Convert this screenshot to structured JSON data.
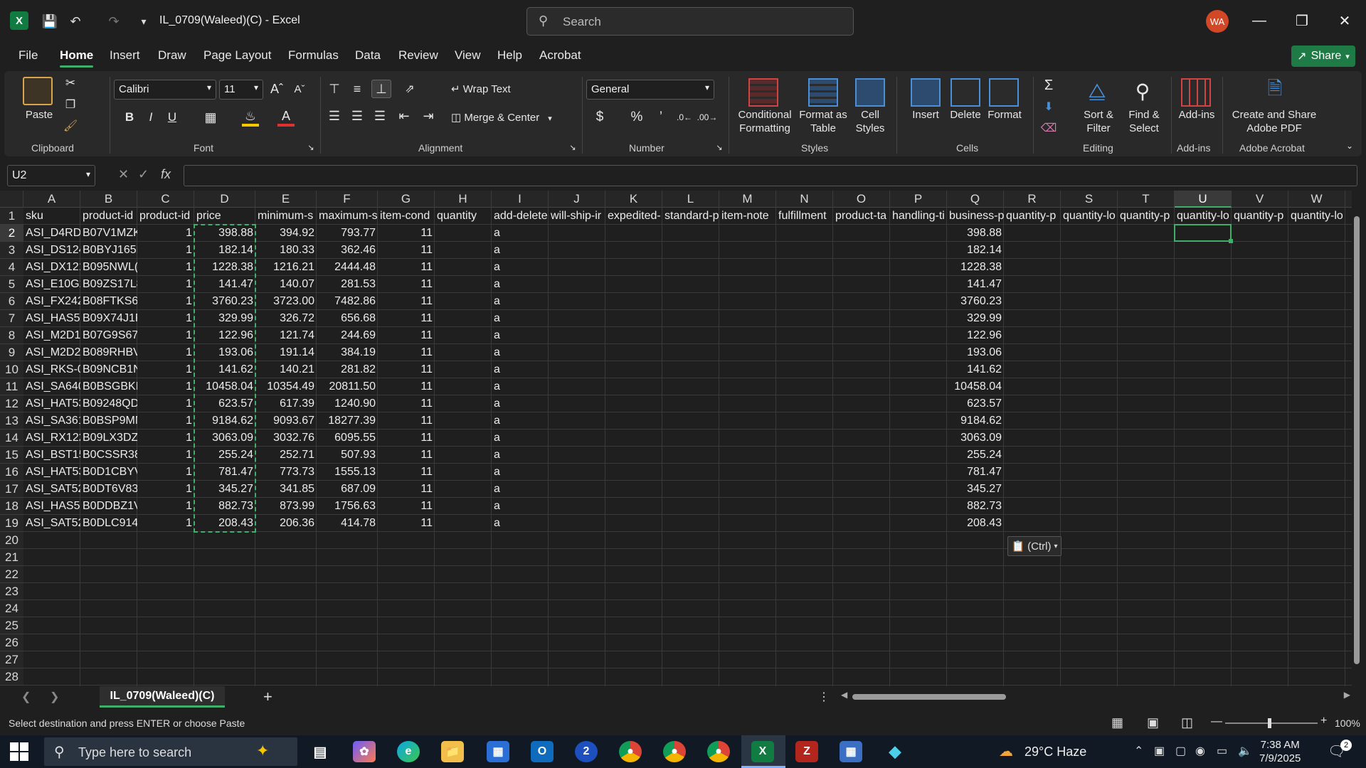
{
  "window": {
    "title": "IL_0709(Waleed)(C)  -  Excel",
    "search_placeholder": "Search",
    "user_initials": "WA"
  },
  "menu": {
    "tabs": [
      "File",
      "Home",
      "Insert",
      "Draw",
      "Page Layout",
      "Formulas",
      "Data",
      "Review",
      "View",
      "Help",
      "Acrobat"
    ],
    "active_tab": "Home",
    "share_label": "Share"
  },
  "ribbon": {
    "clipboard": {
      "paste_label": "Paste",
      "group_label": "Clipboard"
    },
    "font": {
      "font_name": "Calibri",
      "font_size": "11",
      "group_label": "Font",
      "bold": "B",
      "italic": "I",
      "underline": "U"
    },
    "alignment": {
      "wrap_text": "Wrap Text",
      "merge_center": "Merge & Center",
      "group_label": "Alignment"
    },
    "number": {
      "format": "General",
      "group_label": "Number"
    },
    "styles": {
      "conditional_formatting": "Conditional Formatting",
      "format_as_table": "Format as Table",
      "cell_styles": "Cell Styles",
      "group_label": "Styles"
    },
    "cells": {
      "insert": "Insert",
      "delete": "Delete",
      "format": "Format",
      "group_label": "Cells"
    },
    "editing": {
      "sort_filter": "Sort & Filter",
      "find_select": "Find & Select",
      "group_label": "Editing"
    },
    "addins": {
      "addins": "Add-ins",
      "group_label": "Add-ins"
    },
    "acrobat": {
      "create_share": "Create and Share Adobe PDF",
      "group_label": "Adobe Acrobat"
    }
  },
  "formula_bar": {
    "name_box": "U2",
    "fx": "fx",
    "formula": ""
  },
  "grid": {
    "columns": [
      "A",
      "B",
      "C",
      "D",
      "E",
      "F",
      "G",
      "H",
      "I",
      "J",
      "K",
      "L",
      "M",
      "N",
      "O",
      "P",
      "Q",
      "R",
      "S",
      "T",
      "U",
      "V",
      "W"
    ],
    "selected_column": "U",
    "row_numbers": [
      "1",
      "2",
      "3",
      "4",
      "5",
      "6",
      "7",
      "8",
      "9",
      "10",
      "11",
      "12",
      "13",
      "14",
      "15",
      "16",
      "17",
      "18",
      "19",
      "20",
      "21",
      "22",
      "23",
      "24",
      "25",
      "26",
      "27",
      "28"
    ],
    "selected_row": "2",
    "header_row": [
      "sku",
      "product-id",
      "product-id",
      "price",
      "minimum-s",
      "maximum-s",
      "item-cond",
      "quantity",
      "add-delete",
      "will-ship-ir",
      "expedited-",
      "standard-p",
      "item-note",
      "fulfillment",
      "product-ta",
      "handling-ti",
      "business-p",
      "quantity-p",
      "quantity-lo",
      "quantity-p",
      "quantity-lo",
      "quantity-p",
      "quantity-lo"
    ],
    "rows": [
      [
        "ASI_D4RD-",
        "B07V1MZK",
        "1",
        "398.88",
        "394.92",
        "793.77",
        "11",
        "",
        "a",
        "",
        "",
        "",
        "",
        "",
        "",
        "",
        "398.88"
      ],
      [
        "ASI_DS124",
        "B0BYJ165F",
        "1",
        "182.14",
        "180.33",
        "362.46",
        "11",
        "",
        "a",
        "",
        "",
        "",
        "",
        "",
        "",
        "",
        "182.14"
      ],
      [
        "ASI_DX121",
        "B095NWL(",
        "1",
        "1228.38",
        "1216.21",
        "2444.48",
        "11",
        "",
        "a",
        "",
        "",
        "",
        "",
        "",
        "",
        "",
        "1228.38"
      ],
      [
        "ASI_E10G2",
        "B09ZS17L8",
        "1",
        "141.47",
        "140.07",
        "281.53",
        "11",
        "",
        "a",
        "",
        "",
        "",
        "",
        "",
        "",
        "",
        "141.47"
      ],
      [
        "ASI_FX242",
        "B08FTKS6S",
        "1",
        "3760.23",
        "3723.00",
        "7482.86",
        "11",
        "",
        "a",
        "",
        "",
        "",
        "",
        "",
        "",
        "",
        "3760.23"
      ],
      [
        "ASI_HAS53",
        "B09X74J1F",
        "1",
        "329.99",
        "326.72",
        "656.68",
        "11",
        "",
        "a",
        "",
        "",
        "",
        "",
        "",
        "",
        "",
        "329.99"
      ],
      [
        "ASI_M2D1",
        "B07G9S67-",
        "1",
        "122.96",
        "121.74",
        "244.69",
        "11",
        "",
        "a",
        "",
        "",
        "",
        "",
        "",
        "",
        "",
        "122.96"
      ],
      [
        "ASI_M2D2",
        "B089RHBV",
        "1",
        "193.06",
        "191.14",
        "384.19",
        "11",
        "",
        "a",
        "",
        "",
        "",
        "",
        "",
        "",
        "",
        "193.06"
      ],
      [
        "ASI_RKS-0",
        "B09NCB1N",
        "1",
        "141.62",
        "140.21",
        "281.82",
        "11",
        "",
        "a",
        "",
        "",
        "",
        "",
        "",
        "",
        "",
        "141.62"
      ],
      [
        "ASI_SA640",
        "B0BSGBKN",
        "1",
        "10458.04",
        "10354.49",
        "20811.50",
        "11",
        "",
        "a",
        "",
        "",
        "",
        "",
        "",
        "",
        "",
        "10458.04"
      ],
      [
        "ASI_HAT53",
        "B09248QD",
        "1",
        "623.57",
        "617.39",
        "1240.90",
        "11",
        "",
        "a",
        "",
        "",
        "",
        "",
        "",
        "",
        "",
        "623.57"
      ],
      [
        "ASI_SA361",
        "B0BSP9MN",
        "1",
        "9184.62",
        "9093.67",
        "18277.39",
        "11",
        "",
        "a",
        "",
        "",
        "",
        "",
        "",
        "",
        "",
        "9184.62"
      ],
      [
        "ASI_RX122",
        "B09LX3DZ(",
        "1",
        "3063.09",
        "3032.76",
        "6095.55",
        "11",
        "",
        "a",
        "",
        "",
        "",
        "",
        "",
        "",
        "",
        "3063.09"
      ],
      [
        "ASI_BST15",
        "B0CSSR38I",
        "1",
        "255.24",
        "252.71",
        "507.93",
        "11",
        "",
        "a",
        "",
        "",
        "",
        "",
        "",
        "",
        "",
        "255.24"
      ],
      [
        "ASI_HAT53",
        "B0D1CBYV",
        "1",
        "781.47",
        "773.73",
        "1555.13",
        "11",
        "",
        "a",
        "",
        "",
        "",
        "",
        "",
        "",
        "",
        "781.47"
      ],
      [
        "ASI_SAT52",
        "B0DT6V83",
        "1",
        "345.27",
        "341.85",
        "687.09",
        "11",
        "",
        "a",
        "",
        "",
        "",
        "",
        "",
        "",
        "",
        "345.27"
      ],
      [
        "ASI_HAS53",
        "B0DDBZ1V",
        "1",
        "882.73",
        "873.99",
        "1756.63",
        "11",
        "",
        "a",
        "",
        "",
        "",
        "",
        "",
        "",
        "",
        "882.73"
      ],
      [
        "ASI_SAT52",
        "B0DLC914",
        "1",
        "208.43",
        "206.36",
        "414.78",
        "11",
        "",
        "a",
        "",
        "",
        "",
        "",
        "",
        "",
        "",
        "208.43"
      ]
    ],
    "paste_options": "(Ctrl)"
  },
  "sheet": {
    "tab_name": "IL_0709(Waleed)(C)",
    "add_sheet": "+"
  },
  "status": {
    "message": "Select destination and press ENTER or choose Paste",
    "zoom": "100%"
  },
  "taskbar": {
    "search_placeholder": "Type here to search",
    "weather": "29°C  Haze",
    "time": "7:38 AM",
    "date": "7/9/2025",
    "notification_count": "2"
  }
}
